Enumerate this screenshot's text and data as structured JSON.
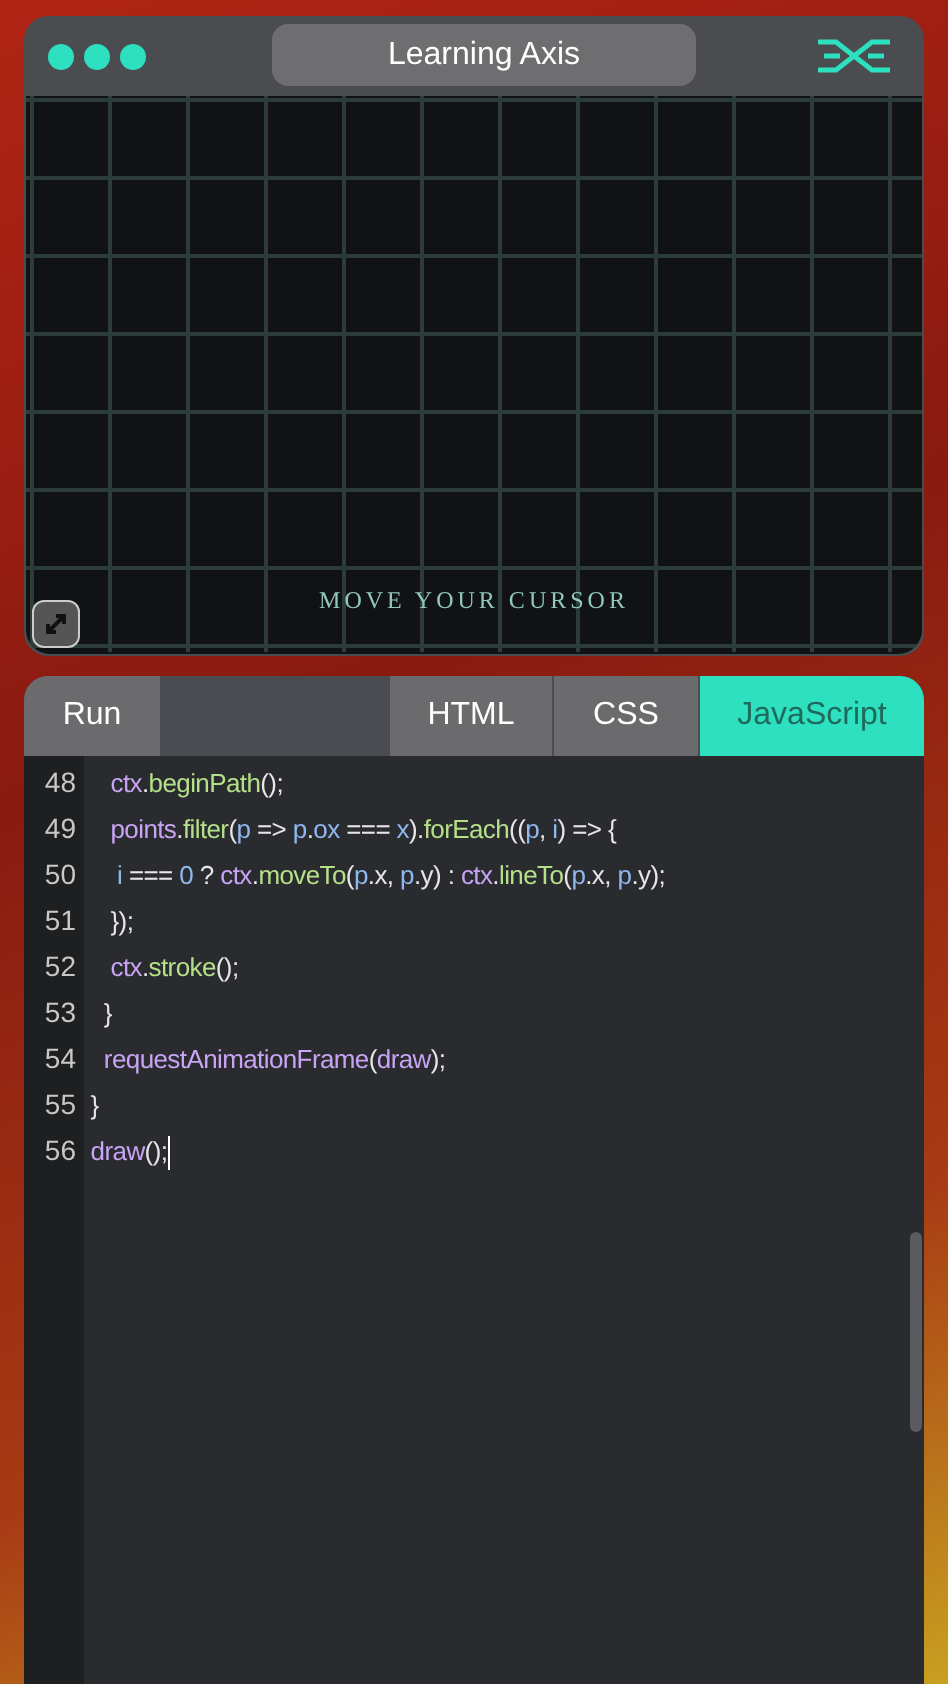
{
  "window": {
    "title": "Learning Axis"
  },
  "canvas": {
    "caption": "MOVE YOUR CURSOR"
  },
  "run_button": "Run",
  "tabs": [
    {
      "label": "HTML",
      "selected": false
    },
    {
      "label": "CSS",
      "selected": false
    },
    {
      "label": "JavaScript",
      "selected": true
    }
  ],
  "code_lines": [
    {
      "number": "48",
      "tokens": [
        {
          "text": "    ctx",
          "kind": "var"
        },
        {
          "text": ".",
          "kind": "plain"
        },
        {
          "text": "beginPath",
          "kind": "fn"
        },
        {
          "text": "();",
          "kind": "plain"
        }
      ]
    },
    {
      "number": "49",
      "tokens": [
        {
          "text": "    points",
          "kind": "var"
        },
        {
          "text": ".",
          "kind": "plain"
        },
        {
          "text": "filter",
          "kind": "fn"
        },
        {
          "text": "(",
          "kind": "plain"
        },
        {
          "text": "p",
          "kind": "id"
        },
        {
          "text": " => ",
          "kind": "plain"
        },
        {
          "text": "p",
          "kind": "id"
        },
        {
          "text": ".",
          "kind": "plain"
        },
        {
          "text": "ox",
          "kind": "id"
        },
        {
          "text": " === ",
          "kind": "plain"
        },
        {
          "text": "x",
          "kind": "id"
        },
        {
          "text": ").",
          "kind": "plain"
        },
        {
          "text": "forEach",
          "kind": "fn"
        },
        {
          "text": "((",
          "kind": "plain"
        },
        {
          "text": "p",
          "kind": "id"
        },
        {
          "text": ", ",
          "kind": "plain"
        },
        {
          "text": "i",
          "kind": "id"
        },
        {
          "text": ") => {",
          "kind": "plain"
        }
      ]
    },
    {
      "number": "50",
      "tokens": [
        {
          "text": "     i",
          "kind": "id"
        },
        {
          "text": " === ",
          "kind": "plain"
        },
        {
          "text": "0",
          "kind": "id"
        },
        {
          "text": " ? ",
          "kind": "plain"
        },
        {
          "text": "ctx",
          "kind": "var"
        },
        {
          "text": ".",
          "kind": "plain"
        },
        {
          "text": "moveTo",
          "kind": "fn"
        },
        {
          "text": "(",
          "kind": "plain"
        },
        {
          "text": "p",
          "kind": "id"
        },
        {
          "text": ".x, ",
          "kind": "plain"
        },
        {
          "text": "p",
          "kind": "id"
        },
        {
          "text": ".y) : ",
          "kind": "plain"
        },
        {
          "text": "ctx",
          "kind": "var"
        },
        {
          "text": ".",
          "kind": "plain"
        },
        {
          "text": "lineTo",
          "kind": "fn"
        },
        {
          "text": "(",
          "kind": "plain"
        },
        {
          "text": "p",
          "kind": "id"
        },
        {
          "text": ".x, ",
          "kind": "plain"
        },
        {
          "text": "p",
          "kind": "id"
        },
        {
          "text": ".y);",
          "kind": "plain"
        }
      ]
    },
    {
      "number": "51",
      "tokens": [
        {
          "text": "    });",
          "kind": "plain"
        }
      ]
    },
    {
      "number": "52",
      "tokens": [
        {
          "text": "    ctx",
          "kind": "var"
        },
        {
          "text": ".",
          "kind": "plain"
        },
        {
          "text": "stroke",
          "kind": "fn"
        },
        {
          "text": "();",
          "kind": "plain"
        }
      ]
    },
    {
      "number": "53",
      "tokens": [
        {
          "text": "   }",
          "kind": "plain"
        }
      ]
    },
    {
      "number": "54",
      "tokens": [
        {
          "text": "   requestAnimationFrame",
          "kind": "var"
        },
        {
          "text": "(",
          "kind": "plain"
        },
        {
          "text": "draw",
          "kind": "var"
        },
        {
          "text": ");",
          "kind": "plain"
        }
      ]
    },
    {
      "number": "55",
      "tokens": [
        {
          "text": " }",
          "kind": "plain"
        }
      ]
    },
    {
      "number": "56",
      "tokens": [
        {
          "text": " draw",
          "kind": "var"
        },
        {
          "text": "();",
          "kind": "plain"
        }
      ]
    }
  ]
}
